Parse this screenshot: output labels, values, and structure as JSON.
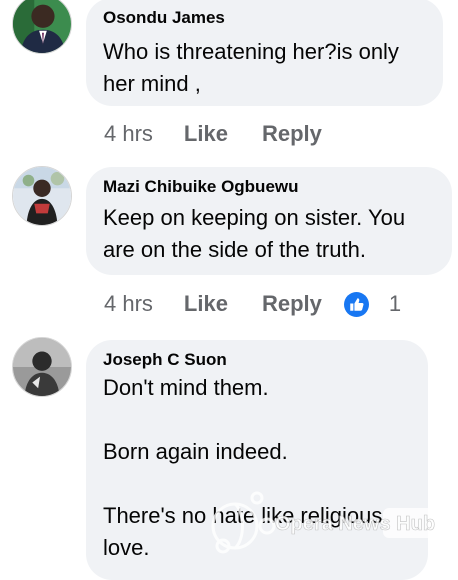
{
  "comments": [
    {
      "author": "Osondu James",
      "text": "Who is threatening her?is only her mind ,",
      "time": "4 hrs",
      "like_label": "Like",
      "reply_label": "Reply"
    },
    {
      "author": "Mazi Chibuike Ogbuewu",
      "text": "Keep on keeping on sister. You are on the side of the truth.",
      "time": "4 hrs",
      "like_label": "Like",
      "reply_label": "Reply",
      "reaction_count": "1"
    },
    {
      "author": "Joseph C Suon",
      "text": "Don't mind them.\n\nBorn again indeed.\n\nThere's no hate like religious love."
    }
  ],
  "watermark": "Opera News Hub",
  "colors": {
    "bubble": "#f0f2f5",
    "meta_text": "#65676b",
    "like_reaction": "#1877f2"
  },
  "icons": {
    "reaction": "thumbs-up-icon"
  }
}
